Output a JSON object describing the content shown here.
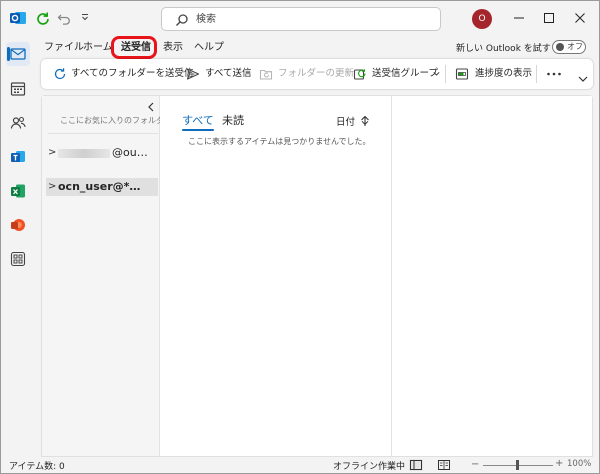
{
  "window": {
    "search_placeholder": "検索",
    "avatar_initial": "O"
  },
  "ribbon": {
    "tabs": [
      {
        "label": "ファイル"
      },
      {
        "label": "ホーム"
      },
      {
        "label": "送受信",
        "selected": true,
        "highlighted": true
      },
      {
        "label": "表示"
      },
      {
        "label": "ヘルプ"
      }
    ],
    "new_outlook_label": "新しい Outlook を試す",
    "toggle_label": "オフ",
    "toggle_on": false
  },
  "commands": {
    "send_receive_all": "すべてのフォルダーを送受信",
    "send_all": "すべて送信",
    "update_folder": "フォルダーの更新",
    "send_receive_groups": "送受信グループ",
    "show_progress": "進捗度の表示"
  },
  "folder_pane": {
    "favorites_hint": "ここにお気に入りのフォルダーをドラッグします",
    "accounts": [
      {
        "label": "@ou…",
        "partially_hidden": true
      },
      {
        "label": "ocn_user@*…",
        "selected": true
      }
    ]
  },
  "message_list": {
    "pivot_all": "すべて",
    "pivot_unread": "未読",
    "active_pivot": "すべて",
    "sort_label": "日付",
    "empty_text": "ここに表示するアイテムは見つかりませんでした。"
  },
  "status_bar": {
    "items_count": "アイテム数: 0",
    "offline": "オフライン作業中",
    "zoom_minus": "−",
    "zoom_plus": "+",
    "zoom_level": "100%",
    "zoom_percent": 100
  },
  "colors": {
    "accent": "#0f6cbd",
    "highlight_ring": "#e8141a",
    "avatar": "#a4262c"
  }
}
